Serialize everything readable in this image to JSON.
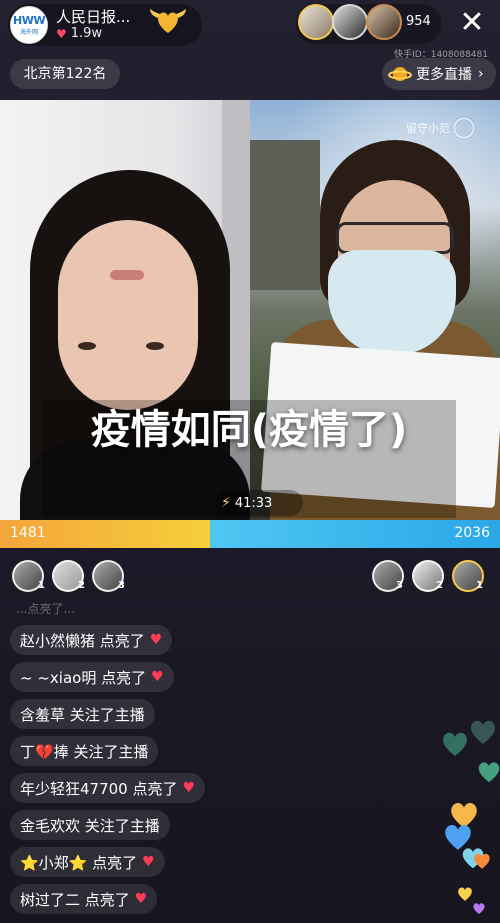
{
  "host": {
    "name": "人民日报...",
    "likes": "1.9w",
    "logo_main": "HWW",
    "logo_sub": "海外网"
  },
  "viewers": {
    "count": "954"
  },
  "id_label": "快手ID：1408088481",
  "rank": "北京第122名",
  "more_live": "更多直播",
  "watermark": "留守小范",
  "headline": "疫情如同(疫情了)",
  "timer": "41:33",
  "pk": {
    "left_score": "1481",
    "right_score": "2036",
    "left_ratio": 0.42
  },
  "contributors_left": [
    "1",
    "2",
    "3"
  ],
  "contributors_right": [
    "3",
    "2",
    "1"
  ],
  "comments": {
    "faded": "...点亮了...",
    "items": [
      {
        "text": "赵小然懒猪 点亮了",
        "heart": true
      },
      {
        "text": "~ ~xiao明 点亮了",
        "heart": true
      },
      {
        "text": "含羞草 关注了主播",
        "heart": false
      },
      {
        "text": "丁💔捧 关注了主播",
        "heart": false
      },
      {
        "text": "年少轻狂47700 点亮了",
        "heart": true
      },
      {
        "text": "金毛欢欢 关注了主播",
        "heart": false
      },
      {
        "text": "⭐小郑⭐ 点亮了",
        "heart": true
      },
      {
        "text": "树过了二 点亮了",
        "heart": true
      }
    ]
  },
  "colors": {
    "pk_left": "#f5b73b",
    "pk_right": "#36b1ec",
    "heart_red": "#ff3b55"
  },
  "icons": {
    "follow": "golden-heart-wings-icon",
    "close": "close-icon",
    "planet": "planet-icon",
    "heart": "heart-icon"
  }
}
